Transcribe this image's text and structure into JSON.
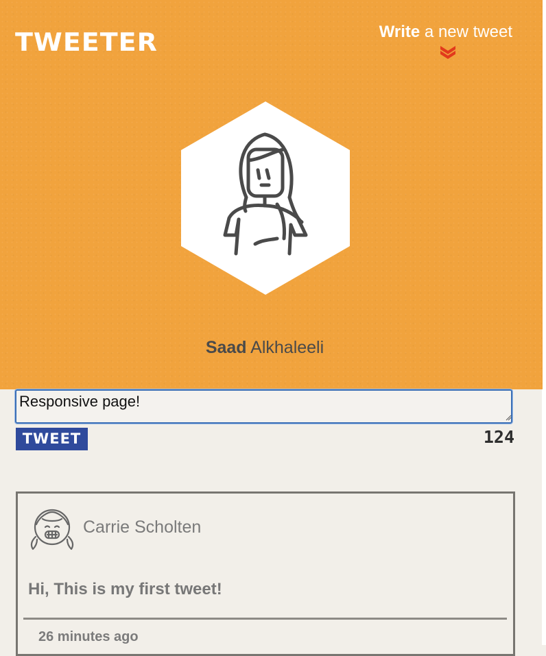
{
  "colors": {
    "header_bg": "#f1a33d",
    "page_bg": "#f2efe9",
    "tweet_button_bg": "#2f4a9c",
    "chevron": "#e23a1c"
  },
  "header": {
    "brand": "TWEETER",
    "compose_toggle": {
      "strong": "Write",
      "rest": "a new tweet",
      "icon": "chevron-double-down-icon"
    },
    "avatar_icon": "woman-avatar-icon",
    "user": {
      "first_name": "Saad",
      "last_name": "Alkhaleeli"
    }
  },
  "compose": {
    "input_value": "Responsive page!",
    "button_label": "TWEET",
    "counter": "124"
  },
  "tweets": [
    {
      "avatar_icon": "girl-avatar-icon",
      "author": "Carrie Scholten",
      "text": "Hi, This is my first tweet!",
      "time": "26 minutes ago"
    }
  ]
}
